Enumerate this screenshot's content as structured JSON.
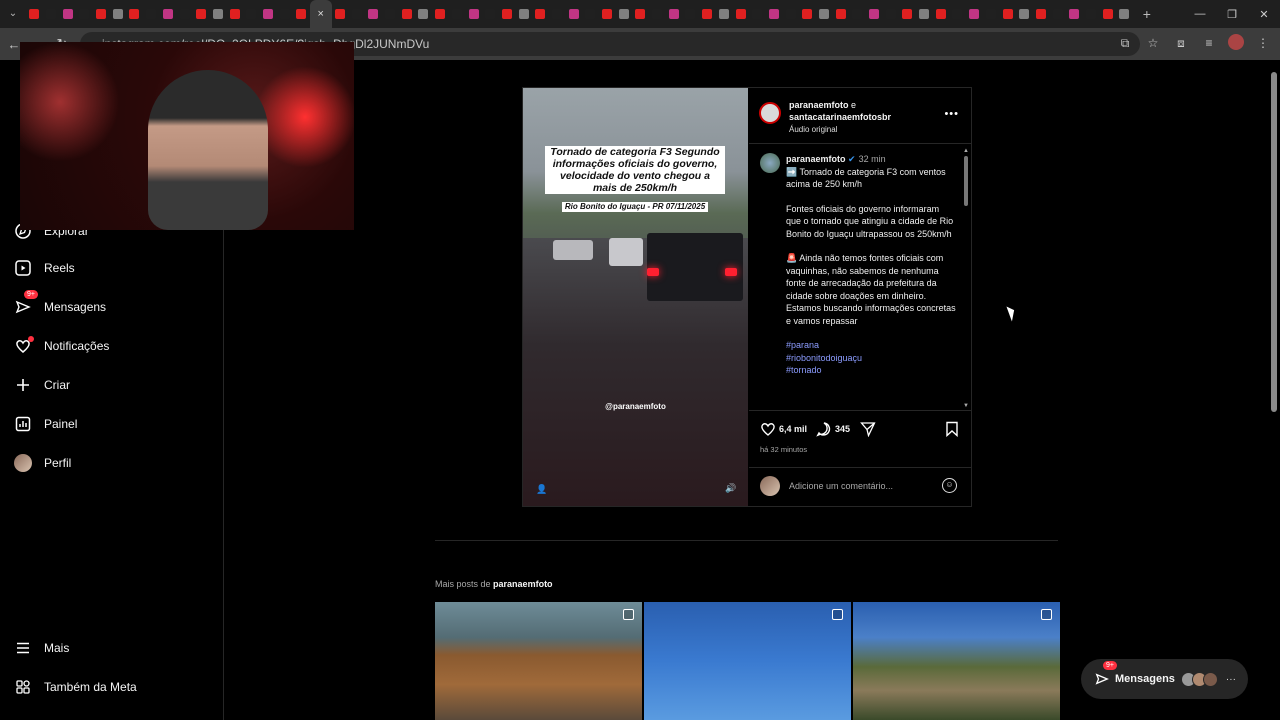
{
  "browser": {
    "url": "instagram.com/reel/DQ_2OLPDY6E/?igsh=DhgDl2JUNmDVu",
    "tab_count": 66,
    "active_tab_index": 17,
    "close_tab_glyph": "×",
    "new_tab_glyph": "+"
  },
  "sidebar": {
    "items": [
      {
        "label": "Explorar",
        "icon": "compass-icon"
      },
      {
        "label": "Reels",
        "icon": "reels-icon"
      },
      {
        "label": "Mensagens",
        "icon": "messenger-icon",
        "badge": "9+"
      },
      {
        "label": "Notificações",
        "icon": "heart-icon",
        "dot": true
      },
      {
        "label": "Criar",
        "icon": "plus-icon"
      },
      {
        "label": "Painel",
        "icon": "dashboard-icon"
      },
      {
        "label": "Perfil",
        "icon": "avatar"
      },
      {
        "label": "Mais",
        "icon": "menu-icon"
      },
      {
        "label": "Também da Meta",
        "icon": "meta-icon"
      }
    ]
  },
  "post": {
    "video": {
      "caption": "Tornado de categoria F3 Segundo informações oficiais do governo, velocidade do vento chegou a mais de 250km/h",
      "location": "Rio Bonito do Iguaçu - PR 07/11/2025",
      "handle": "@paranaemfoto"
    },
    "header": {
      "user1": "paranaemfoto",
      "conjunction": "e",
      "user2": "santacatarinaemfotosbr",
      "audio": "Áudio original"
    },
    "caption": {
      "user": "paranaemfoto",
      "time": "32 min",
      "line1": "➡️ Tornado de categoria F3 com ventos acima de 250 km/h",
      "line2": "Fontes oficiais do governo informaram que o tornado que atingiu a cidade de Rio Bonito do Iguaçu ultrapassou os 250km/h",
      "line3": "🚨 Ainda não temos fontes oficiais com vaquinhas, não sabemos de nenhuma fonte de arrecadação da prefeitura da cidade sobre doações em dinheiro. Estamos buscando informações concretas e vamos repassar",
      "hashtags": [
        "#parana",
        "#riobonitodoiguaçu",
        "#tornado"
      ]
    },
    "likes": "6,4 mil",
    "comments": "345",
    "time_ago": "há 32 minutos",
    "comment_placeholder": "Adicione um comentário..."
  },
  "more_posts": {
    "prefix": "Mais posts de",
    "user": "paranaemfoto"
  },
  "messages_float": {
    "label": "Mensagens",
    "badge": "9+"
  }
}
